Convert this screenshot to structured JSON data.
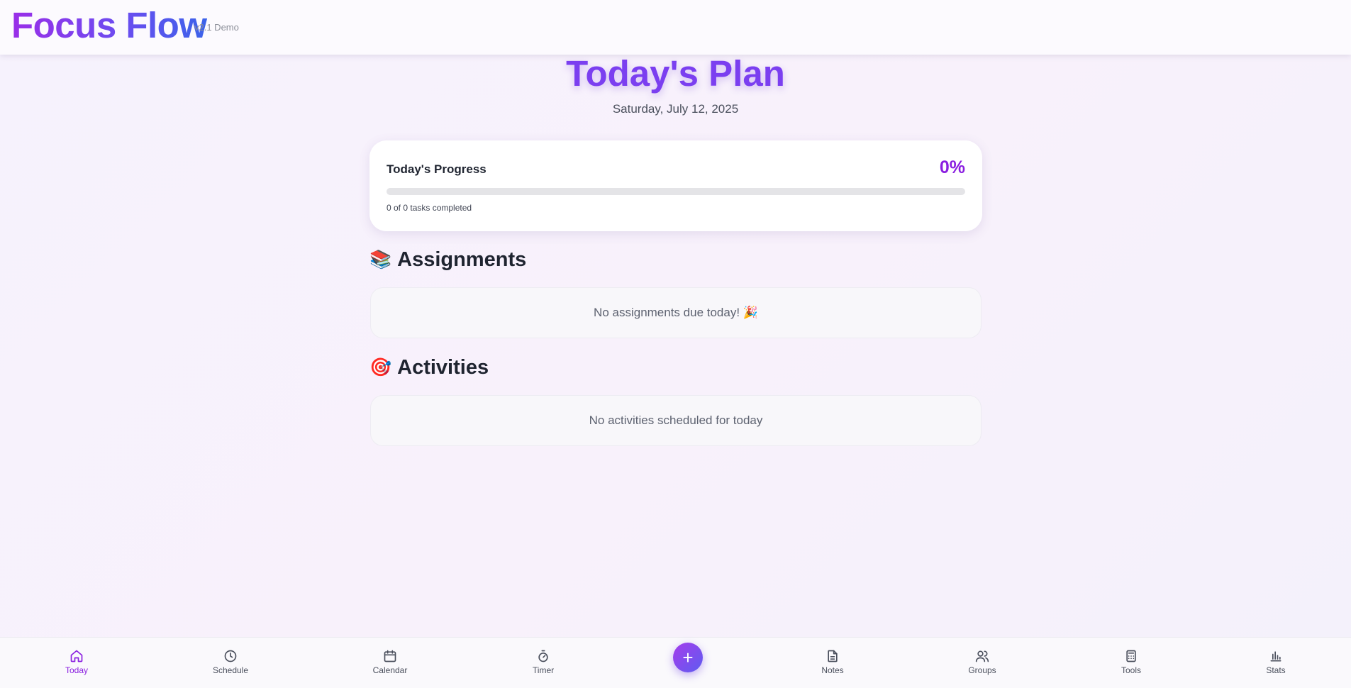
{
  "header": {
    "app_name": "Focus Flow",
    "version": "v2.1 Demo"
  },
  "main": {
    "title": "Today's Plan",
    "date": "Saturday, July 12, 2025",
    "progress": {
      "label": "Today's Progress",
      "percent_text": "0%",
      "percent_value": 0,
      "caption": "0 of 0 tasks completed"
    },
    "assignments": {
      "icon": "books-emoji",
      "emoji": "📚",
      "heading": "Assignments",
      "empty_text": "No assignments due today! 🎉"
    },
    "activities": {
      "icon": "target-emoji",
      "emoji": "🎯",
      "heading": "Activities",
      "empty_text": "No activities scheduled for today"
    }
  },
  "nav": {
    "items": [
      {
        "label": "Today",
        "icon": "home-icon",
        "active": true
      },
      {
        "label": "Schedule",
        "icon": "clock-icon",
        "active": false
      },
      {
        "label": "Calendar",
        "icon": "calendar-icon",
        "active": false
      },
      {
        "label": "Timer",
        "icon": "stopwatch-icon",
        "active": false
      },
      {
        "label": "Notes",
        "icon": "document-icon",
        "active": false
      },
      {
        "label": "Groups",
        "icon": "users-icon",
        "active": false
      },
      {
        "label": "Tools",
        "icon": "calculator-icon",
        "active": false
      },
      {
        "label": "Stats",
        "icon": "bar-chart-icon",
        "active": false
      }
    ],
    "fab_label": "+",
    "fab_icon": "plus-icon"
  },
  "colors": {
    "accent": "#8a1ee0",
    "title": "#7b3ff0",
    "brand_start": "#9a2ee8",
    "brand_end": "#3b63ea"
  }
}
